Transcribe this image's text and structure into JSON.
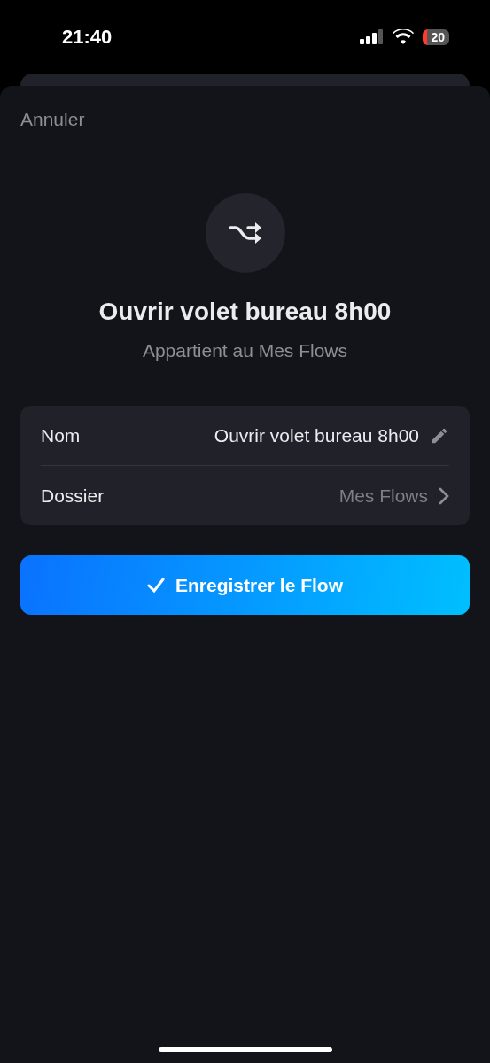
{
  "status_bar": {
    "time": "21:40",
    "battery": "20"
  },
  "sheet": {
    "cancel": "Annuler",
    "title": "Ouvrir volet bureau 8h00",
    "subtitle": "Appartient au Mes Flows",
    "rows": [
      {
        "kind": "edit",
        "label": "Nom",
        "value": "Ouvrir volet bureau 8h00"
      },
      {
        "kind": "link",
        "label": "Dossier",
        "value": "Mes Flows"
      }
    ],
    "save_button": "Enregistrer le Flow"
  }
}
